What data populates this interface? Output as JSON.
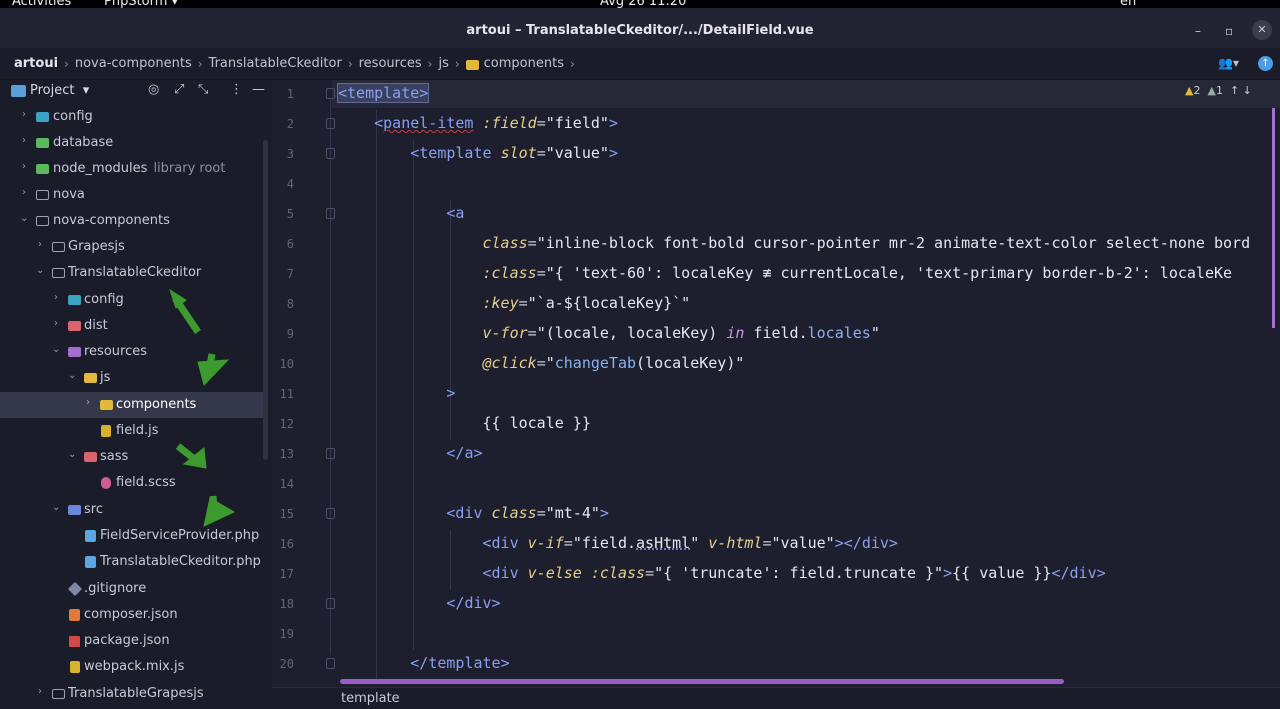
{
  "topbar": {
    "activities": "Activities",
    "app": "PhpStorm",
    "clock": "Avg 26  11:20",
    "lang": "en"
  },
  "window": {
    "title": "artoui – TranslatableCkeditor/.../DetailField.vue"
  },
  "breadcrumb": {
    "items": [
      "artoui",
      "nova-components",
      "TranslatableCkeditor",
      "resources",
      "js",
      "components"
    ]
  },
  "project_panel": {
    "title": "Project",
    "tree": [
      {
        "label": "config",
        "sub": ""
      },
      {
        "label": "database",
        "sub": ""
      },
      {
        "label": "node_modules",
        "sub": "library root"
      },
      {
        "label": "nova",
        "sub": ""
      },
      {
        "label": "nova-components",
        "sub": ""
      },
      {
        "label": "Grapesjs",
        "sub": ""
      },
      {
        "label": "TranslatableCkeditor",
        "sub": ""
      },
      {
        "label": "config",
        "sub": ""
      },
      {
        "label": "dist",
        "sub": ""
      },
      {
        "label": "resources",
        "sub": ""
      },
      {
        "label": "js",
        "sub": ""
      },
      {
        "label": "components",
        "sub": ""
      },
      {
        "label": "field.js",
        "sub": ""
      },
      {
        "label": "sass",
        "sub": ""
      },
      {
        "label": "field.scss",
        "sub": ""
      },
      {
        "label": "src",
        "sub": ""
      },
      {
        "label": "FieldServiceProvider.php",
        "sub": ""
      },
      {
        "label": "TranslatableCkeditor.php",
        "sub": ""
      },
      {
        "label": ".gitignore",
        "sub": ""
      },
      {
        "label": "composer.json",
        "sub": ""
      },
      {
        "label": "package.json",
        "sub": ""
      },
      {
        "label": "webpack.mix.js",
        "sub": ""
      },
      {
        "label": "TranslatableGrapesjs",
        "sub": ""
      }
    ]
  },
  "editor": {
    "line_numbers": [
      "1",
      "2",
      "3",
      "4",
      "5",
      "6",
      "7",
      "8",
      "9",
      "10",
      "11",
      "12",
      "13",
      "14",
      "15",
      "16",
      "17",
      "18",
      "19",
      "20"
    ],
    "inspections": {
      "warnings": "2",
      "weak": "1"
    },
    "code": {
      "l1_tag": "template",
      "l2_tag": "panel-item",
      "l2_attr": ":field",
      "l2_val": "\"field\"",
      "l3_tag": "template",
      "l3_attr": "slot",
      "l3_val": "\"value\"",
      "l5_tag": "a",
      "l6_attr": "class",
      "l6_val": "\"inline-block font-bold cursor-pointer mr-2 animate-text-color select-none bord",
      "l7_attr": ":class",
      "l7_val": "\"{ 'text-60': localeKey ≢ currentLocale, 'text-primary border-b-2': localeKe",
      "l8_attr": ":key",
      "l8_val": "\"`a-${localeKey}`\"",
      "l9_attr": "v-for",
      "l9_pre": "\"(locale, localeKey) ",
      "l9_kw": "in",
      "l9_mid": " field.",
      "l9_prop": "locales",
      "l9_end": "\"",
      "l10_attr": "@click",
      "l10_pre": "\"",
      "l10_method": "changeTab",
      "l10_end": "(localeKey)\"",
      "l11": ">",
      "l12": "{{ locale }}",
      "l13_tag": "a",
      "l15_tag": "div",
      "l15_attr": "class",
      "l15_val": "\"mt-4\"",
      "l16_tag": "div",
      "l16_attr1": "v-if",
      "l16_val1a": "\"field.",
      "l16_val1b": "asHtml",
      "l16_val1c": "\"",
      "l16_attr2": "v-html",
      "l16_val2": "\"value\"",
      "l16_close": "div",
      "l17_tag": "div",
      "l17_attr1": "v-else",
      "l17_attr2": ":class",
      "l17_val": "\"{ 'truncate': field.truncate }\"",
      "l17_mid": "{{ value }}",
      "l17_close": "div",
      "l18_tag": "div",
      "l20_tag": "template"
    }
  },
  "status": {
    "breadcrumb": "template"
  }
}
